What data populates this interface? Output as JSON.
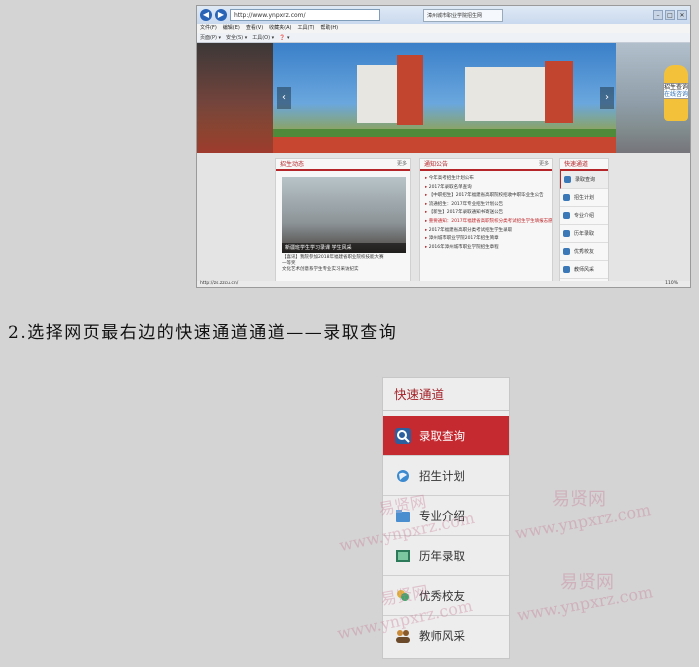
{
  "browser": {
    "address": "http://www.ynpxrz.com/",
    "tab_title": "漳州城市职业学院招生网",
    "menu": [
      "文件(F)",
      "编辑(E)",
      "查看(V)",
      "收藏夹(A)",
      "工具(T)",
      "帮助(H)"
    ],
    "commands": [
      "页面(P) ▾",
      "安全(S) ▾",
      "工具(O) ▾",
      "❓ ▾"
    ],
    "status_url": "http://zs.zzcu.cn/",
    "zoom": "110%"
  },
  "banner": {
    "mascot_label": "招生查询",
    "mascot_sub": "在线咨询"
  },
  "site": {
    "news_header": "招生动态",
    "news_more": "更多",
    "photo_caption": "新疆班学生学习录课 学生风采",
    "news_text_1": "【喜讯】我院参加2018年福建省职业院校技能大赛",
    "news_text_2": "一等奖",
    "news_text_3": "文化艺术创意系学生专业实习采访纪实",
    "notice_header": "通知公告",
    "notice_more": "更多",
    "notices": [
      {
        "text": "今年高考招生计划公布",
        "red": false
      },
      {
        "text": "2017年录取名单查询",
        "red": false
      },
      {
        "text": "【中职招生】2017年福建省高职院校招收中职毕业生公告",
        "red": false
      },
      {
        "text": "流通招生：2017年专业招生计划公告",
        "red": false
      },
      {
        "text": "【新生】2017年录取通知书寄送公告",
        "red": false
      },
      {
        "text": "重要通知：2017年福建省高职院校分类考试招生学生填报志愿的通知",
        "red": true
      },
      {
        "text": "2017年福建省高职分类考试招生学生录取",
        "red": false
      },
      {
        "text": "漳州城市职业学院2017年招生简章",
        "red": false
      },
      {
        "text": "2016年漳州城市职业学院招生章程",
        "red": false
      }
    ],
    "quick_header": "快速通道",
    "quick_small": [
      "录取查询",
      "招生计划",
      "专业介绍",
      "历年录取",
      "优秀校友",
      "教师风采"
    ]
  },
  "caption": "2.选择网页最右边的快速通道通道——录取查询",
  "panel": {
    "title": "快速通道",
    "items": [
      "录取查询",
      "招生计划",
      "专业介绍",
      "历年录取",
      "优秀校友",
      "教师风采"
    ]
  },
  "watermarks": {
    "cn": "易贤网",
    "en": "www.ynpxrz.com"
  }
}
